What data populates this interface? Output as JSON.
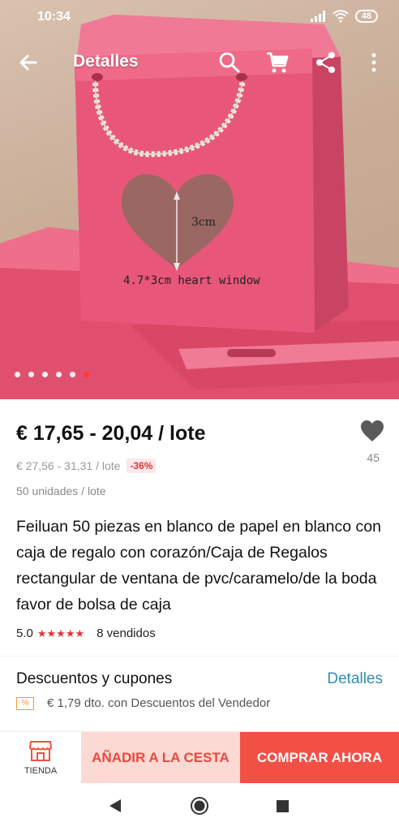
{
  "status_bar": {
    "time": "10:34",
    "battery": "48"
  },
  "toolbar": {
    "title": "Detalles"
  },
  "hero": {
    "dimension_label": "3cm",
    "window_label": "4.7*3cm heart window",
    "slide_count": 6,
    "active_slide": 5
  },
  "product": {
    "price": "€ 17,65 - 20,04 / lote",
    "old_price": "€ 27,56 - 31,31 / lote",
    "discount": "-36%",
    "units": "50 unidades / lote",
    "title": "Feiluan 50 piezas en blanco de papel en blanco con caja de regalo con corazón/Caja de Regalos rectangular de ventana de pvc/caramelo/de la boda favor de bolsa de caja",
    "rating": "5.0",
    "stars": "★★★★★",
    "sold": "8 vendidos",
    "wishlist_count": "45"
  },
  "discounts": {
    "title": "Descuentos y cupones",
    "link": "Detalles",
    "badge": "%",
    "seller_discount": "€ 1,79 dto. con Descuentos del Vendedor"
  },
  "actions": {
    "store": "TIENDA",
    "add_to_cart": "AÑADIR A LA CESTA",
    "buy_now": "COMPRAR AHORA"
  },
  "colors": {
    "accent": "#f24f45",
    "accent_light": "#fcd9d3",
    "link": "#2e8fb3",
    "box_pink": "#e8577a"
  }
}
